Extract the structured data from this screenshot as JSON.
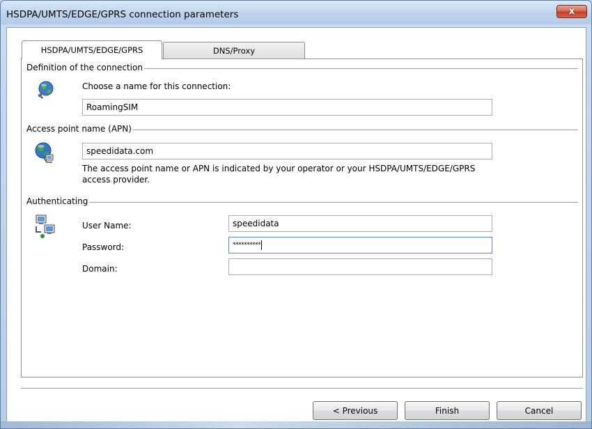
{
  "window": {
    "title": "HSDPA/UMTS/EDGE/GPRS connection parameters",
    "close_glyph": "x"
  },
  "tabs": [
    {
      "label": "HSDPA/UMTS/EDGE/GPRS",
      "active": true
    },
    {
      "label": "DNS/Proxy",
      "active": false
    }
  ],
  "definition": {
    "group_label": "Definition of the connection",
    "prompt": "Choose a name for this connection:",
    "name_value": "RoamingSIM",
    "icon": "globe-connection-icon"
  },
  "apn": {
    "group_label": "Access point name (APN)",
    "value": "speedidata.com",
    "help_line1": "The access point name or APN is indicated by your operator or your HSDPA/UMTS/EDGE/GPRS",
    "help_line2": "access provider.",
    "icon": "globe-network-icon"
  },
  "auth": {
    "group_label": "Authenticating",
    "icon": "network-computers-icon",
    "username_label": "User Name:",
    "username_value": "speedidata",
    "password_label": "Password:",
    "password_value": "**********",
    "domain_label": "Domain:",
    "domain_value": ""
  },
  "buttons": {
    "previous": "< Previous",
    "finish": "Finish",
    "cancel": "Cancel"
  }
}
